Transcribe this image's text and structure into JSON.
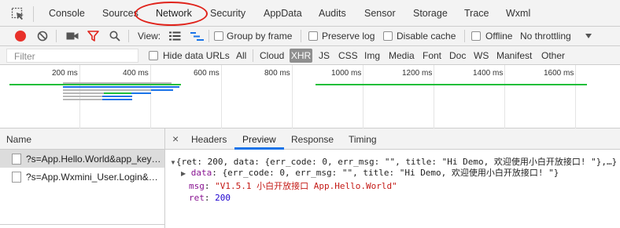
{
  "main_tabs": [
    "Console",
    "Sources",
    "Network",
    "Security",
    "AppData",
    "Audits",
    "Sensor",
    "Storage",
    "Trace",
    "Wxml"
  ],
  "active_tab": "Network",
  "toolbar": {
    "view_label": "View:",
    "group_by_frame": "Group by frame",
    "preserve_log": "Preserve log",
    "disable_cache": "Disable cache",
    "offline": "Offline",
    "throttling": "No throttling"
  },
  "filter": {
    "placeholder": "Filter",
    "hide_data_urls": "Hide data URLs",
    "types": [
      "All",
      "Cloud",
      "XHR",
      "JS",
      "CSS",
      "Img",
      "Media",
      "Font",
      "Doc",
      "WS",
      "Manifest",
      "Other"
    ],
    "active_type": "XHR"
  },
  "timeline": {
    "ticks": [
      "200 ms",
      "400 ms",
      "600 ms",
      "800 ms",
      "1000 ms",
      "1200 ms",
      "1400 ms",
      "1600 ms"
    ]
  },
  "requests": {
    "column_header": "Name",
    "rows": [
      "?s=App.Hello.World&app_key…",
      "?s=App.Wxmini_User.Login&…"
    ]
  },
  "detail": {
    "close_symbol": "×",
    "tabs": [
      "Headers",
      "Preview",
      "Response",
      "Timing"
    ],
    "active_tab": "Preview",
    "preview": {
      "summary": "{ret: 200, data: {err_code: 0, err_msg: \"\", title: \"Hi Demo, 欢迎使用小白开放接口! \"},…}",
      "data_key": "data",
      "data_value": "{err_code: 0, err_msg: \"\", title: \"Hi Demo, 欢迎使用小白开放接口! \"}",
      "msg_key": "msg",
      "msg_value": "\"V1.5.1 小白开放接口 App.Hello.World\"",
      "ret_key": "ret",
      "ret_value": "200"
    }
  },
  "colors": {
    "record": "#e8312a",
    "filter_funnel": "#e0231b",
    "annotation_circle": "#e0231b",
    "active_tab_underline": "#1a73e8",
    "green_bar": "#1fbf3a",
    "blue_bar": "#1a73e8"
  }
}
